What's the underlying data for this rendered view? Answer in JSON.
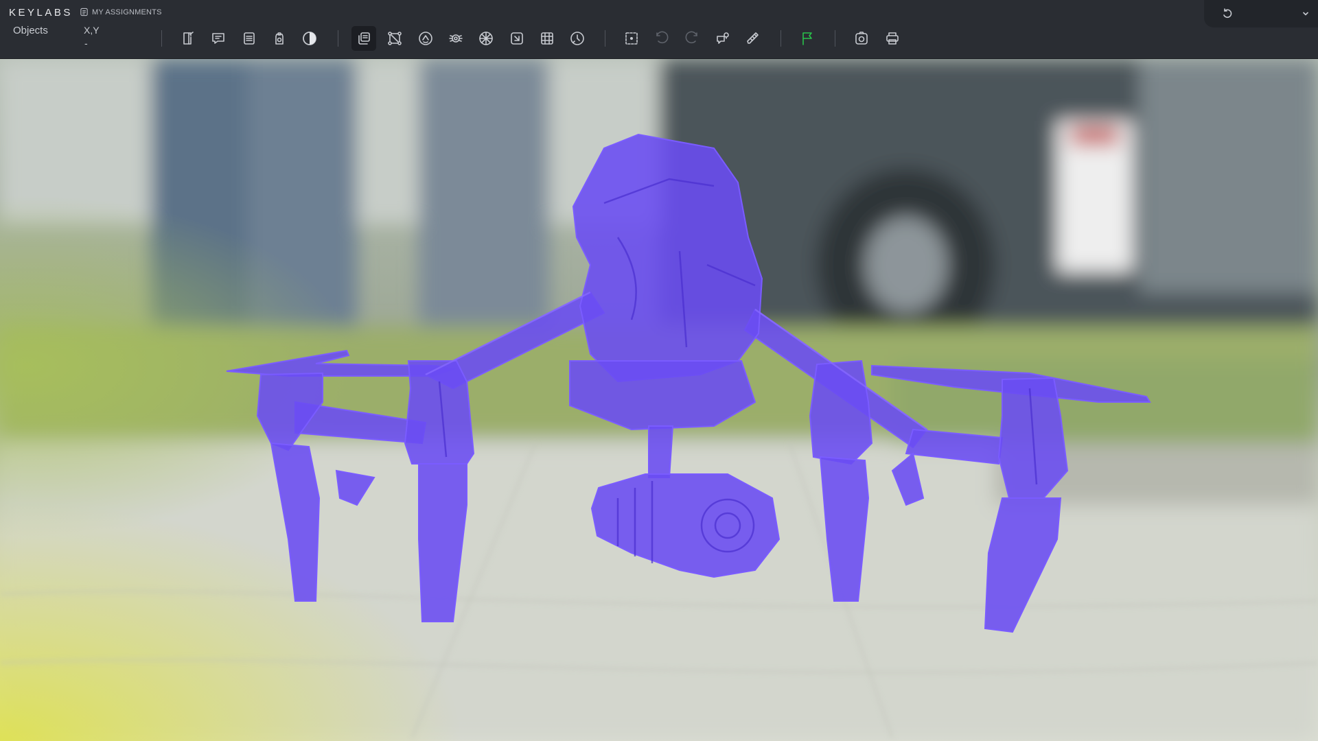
{
  "app": {
    "brand": "KEYLABS",
    "nav_link": "MY ASSIGNMENTS"
  },
  "panel": {
    "objects_label": "Objects",
    "coord_label": "X,Y",
    "coord_value": "-"
  },
  "toolbar": {
    "groups": [
      [
        "new-document-icon",
        "comments-icon",
        "list-icon",
        "clipboard-icon",
        "contrast-icon"
      ],
      [
        "copy-layers-icon",
        "polygon-points-icon",
        "circle-select-icon",
        "layers-icon",
        "pattern-icon",
        "transform-icon",
        "grid-icon",
        "rotate-icon"
      ],
      [
        "selection-box-icon",
        "undo-icon",
        "redo-icon",
        "map-pin-icon",
        "ruler-icon"
      ],
      [
        "flag-icon"
      ],
      [
        "camera-icon",
        "print-icon"
      ]
    ],
    "flag_color": "#29c24a"
  },
  "annotation": {
    "object": "drone",
    "mask_color": "#6a4cf2",
    "mask_outline": "#7a5cff"
  }
}
